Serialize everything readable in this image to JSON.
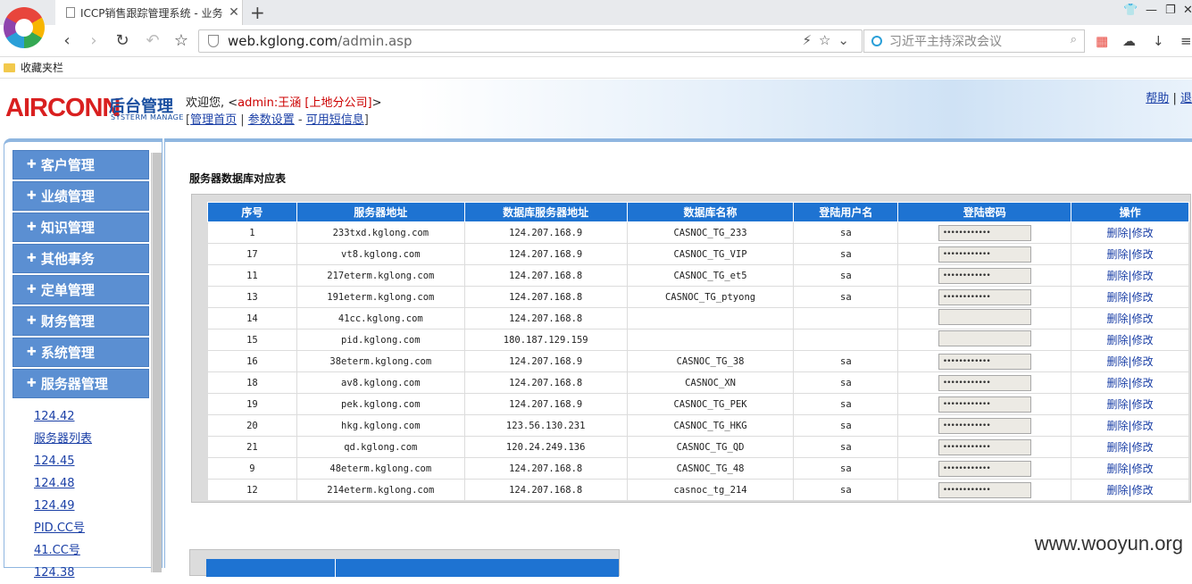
{
  "browser": {
    "tab_title": "ICCP销售跟踪管理系统 - 业务",
    "url_host": "web.kglong.com",
    "url_path": "/admin.asp",
    "search_placeholder": "习近平主持深改会议",
    "bookmarks_label": "收藏夹栏"
  },
  "header": {
    "logo": "AIRCONN",
    "logo_cn": "后台管理",
    "logo_sub": "SYSTERM MANAGE",
    "welcome_prefix": "欢迎您, <",
    "welcome_user": "admin:王涵 [上地分公司]",
    "welcome_suffix": ">",
    "links": [
      "管理首页",
      "参数设置",
      "可用短信息"
    ],
    "help": "帮助",
    "help_sep": "|",
    "logout_partial": "退"
  },
  "menu": {
    "items": [
      "客户管理",
      "业绩管理",
      "知识管理",
      "其他事务",
      "定单管理",
      "财务管理",
      "系统管理",
      "服务器管理"
    ],
    "sub_items": [
      "124.42",
      "服务器列表",
      "124.45",
      "124.48",
      "124.49",
      "PID.CC号",
      "41.CC号",
      "124.38"
    ]
  },
  "main": {
    "title": "服务器数据库对应表",
    "columns": [
      "序号",
      "服务器地址",
      "数据库服务器地址",
      "数据库名称",
      "登陆用户名",
      "登陆密码",
      "操作"
    ],
    "delete_label": "删除",
    "edit_label": "修改",
    "rows": [
      {
        "id": "1",
        "server": "233txd.kglong.com",
        "db_server": "124.207.168.9",
        "db_name": "CASNOC_TG_233",
        "user": "sa",
        "pw": "••••••••••••"
      },
      {
        "id": "17",
        "server": "vt8.kglong.com",
        "db_server": "124.207.168.9",
        "db_name": "CASNOC_TG_VIP",
        "user": "sa",
        "pw": "••••••••••••"
      },
      {
        "id": "11",
        "server": "217eterm.kglong.com",
        "db_server": "124.207.168.8",
        "db_name": "CASNOC_TG_et5",
        "user": "sa",
        "pw": "••••••••••••"
      },
      {
        "id": "13",
        "server": "191eterm.kglong.com",
        "db_server": "124.207.168.8",
        "db_name": "CASNOC_TG_ptyong",
        "user": "sa",
        "pw": "••••••••••••"
      },
      {
        "id": "14",
        "server": "41cc.kglong.com",
        "db_server": "124.207.168.8",
        "db_name": "",
        "user": "",
        "pw": ""
      },
      {
        "id": "15",
        "server": "pid.kglong.com",
        "db_server": "180.187.129.159",
        "db_name": "",
        "user": "",
        "pw": ""
      },
      {
        "id": "16",
        "server": "38eterm.kglong.com",
        "db_server": "124.207.168.9",
        "db_name": "CASNOC_TG_38",
        "user": "sa",
        "pw": "••••••••••••"
      },
      {
        "id": "18",
        "server": "av8.kglong.com",
        "db_server": "124.207.168.8",
        "db_name": "CASNOC_XN",
        "user": "sa",
        "pw": "••••••••••••"
      },
      {
        "id": "19",
        "server": "pek.kglong.com",
        "db_server": "124.207.168.9",
        "db_name": "CASNOC_TG_PEK",
        "user": "sa",
        "pw": "••••••••••••"
      },
      {
        "id": "20",
        "server": "hkg.kglong.com",
        "db_server": "123.56.130.231",
        "db_name": "CASNOC_TG_HKG",
        "user": "sa",
        "pw": "••••••••••••"
      },
      {
        "id": "21",
        "server": "qd.kglong.com",
        "db_server": "120.24.249.136",
        "db_name": "CASNOC_TG_QD",
        "user": "sa",
        "pw": "••••••••••••"
      },
      {
        "id": "9",
        "server": "48eterm.kglong.com",
        "db_server": "124.207.168.8",
        "db_name": "CASNOC_TG_48",
        "user": "sa",
        "pw": "••••••••••••"
      },
      {
        "id": "12",
        "server": "214eterm.kglong.com",
        "db_server": "124.207.168.8",
        "db_name": "casnoc_tg_214",
        "user": "sa",
        "pw": "••••••••••••"
      }
    ]
  },
  "watermark": "www.wooyun.org",
  "colors": {
    "accent": "#1e73d2",
    "menu": "#5b8fd2",
    "logo": "#d92020"
  }
}
